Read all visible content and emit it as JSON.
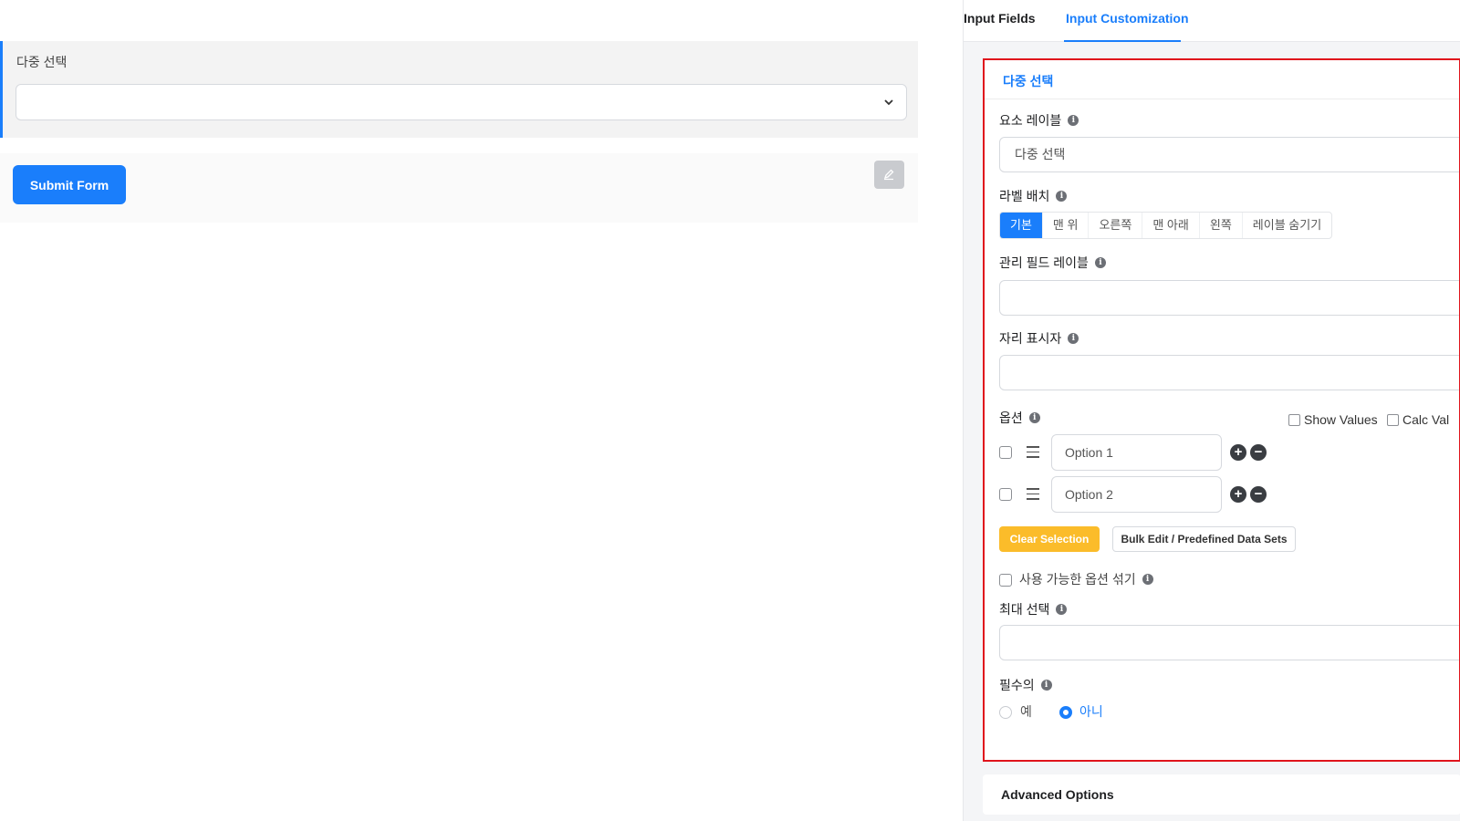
{
  "preview": {
    "field_label": "다중 선택",
    "submit_label": "Submit Form"
  },
  "tabs": [
    {
      "label": "Input Fields"
    },
    {
      "label": "Input Customization"
    }
  ],
  "card": {
    "title": "다중 선택",
    "element_label": {
      "label": "요소 레이블",
      "value": "다중 선택"
    },
    "label_placement": {
      "label": "라벨 배치",
      "options": [
        "기본",
        "맨 위",
        "오른쪽",
        "맨 아래",
        "왼쪽",
        "레이블 숨기기"
      ],
      "selected": "기본"
    },
    "admin_label": {
      "label": "관리 필드 레이블",
      "value": ""
    },
    "placeholder": {
      "label": "자리 표시자",
      "value": ""
    },
    "options_section": {
      "label": "옵션",
      "show_values": "Show Values",
      "calc_values": "Calc Val",
      "items": [
        "Option 1",
        "Option 2"
      ]
    },
    "clear_selection": "Clear Selection",
    "bulk_edit": "Bulk Edit / Predefined Data Sets",
    "shuffle": "사용 가능한 옵션 섞기",
    "max_selection": {
      "label": "최대 선택",
      "value": ""
    },
    "required": {
      "label": "필수의",
      "yes": "예",
      "no": "아니",
      "selected": "아니"
    }
  },
  "advanced": "Advanced Options",
  "colors": {
    "accent": "#1a7efb",
    "highlight_border": "#e0141c",
    "warning": "#fbbc2a"
  }
}
